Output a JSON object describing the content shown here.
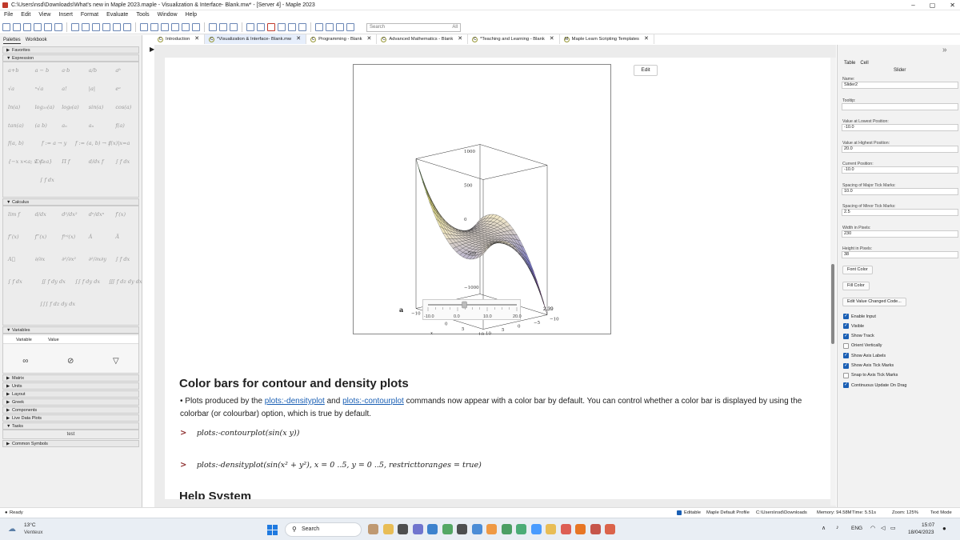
{
  "window": {
    "title": "C:\\Users\\nsd\\Downloads\\What's new in Maple 2023.maple - Visualization & Interface- Blank.mw* - [Server 4] - Maple 2023"
  },
  "menu": [
    "File",
    "Edit",
    "View",
    "Insert",
    "Format",
    "Evaluate",
    "Tools",
    "Window",
    "Help"
  ],
  "toolbar": {
    "search_placeholder": "Search",
    "search_scope": "All"
  },
  "left_panel": {
    "tabs": [
      "Palettes",
      "Workbook"
    ],
    "sections": {
      "favorites": "Favorites",
      "expression": "Expression",
      "calculus": "Calculus",
      "variables": "Variables",
      "matrix": "Matrix",
      "units": "Units",
      "layout": "Layout",
      "greek": "Greek",
      "components": "Components",
      "live_data_plots": "Live Data Plots",
      "tasks": "Tasks",
      "common_symbols": "Common Symbols"
    },
    "variables_cols": [
      "Variable",
      "Value"
    ],
    "tasks_item": "test",
    "expression_items": [
      [
        "a+b",
        "a − b",
        "a·b",
        "a/b",
        "aᵇ"
      ],
      [
        "√a",
        "ⁿ√a",
        "a!",
        "|a|",
        "eᵃ"
      ],
      [
        "ln(a)",
        "log₁₀(a)",
        "logᵦ(a)",
        "sin(a)",
        "cos(a)"
      ],
      [
        "tan(a)",
        "(a b)",
        "aₙ",
        "aₙ",
        "f(a)"
      ],
      [
        "f(a, b)",
        "f := a → y",
        "f := (a, b) → z",
        "f(x)|x=a"
      ],
      [
        "{−x x<a; x x≥a}",
        "Σ f",
        "Π f",
        "d/dx f",
        "∫ f dx"
      ],
      [
        "∫ f dx"
      ]
    ],
    "calculus_items": [
      [
        "lim f",
        "d/dx",
        "d²/dx²",
        "dⁿ/dxⁿ",
        "f′(x)"
      ],
      [
        "f″(x)",
        "f‴(x)",
        "f⁽ⁿ⁾(x)",
        "Ȧ",
        "Ä"
      ],
      [
        "A⃛",
        "∂/∂x",
        "∂²/∂x²",
        "∂²/∂x∂y",
        "∫ f dx"
      ],
      [
        "∫ f dx",
        "∬ f dy dx",
        "∫∫ f dy dx",
        "∭ f dz dy dx"
      ],
      [
        "∫∫∫ f dz dy dx"
      ]
    ]
  },
  "doc_tabs": [
    {
      "label": "Introduction",
      "icon": "C",
      "active": false
    },
    {
      "label": "*Visualization & Interface- Blank.mw",
      "icon": "C",
      "active": true
    },
    {
      "label": "Programming - Blank",
      "icon": "C",
      "active": false
    },
    {
      "label": "Advanced Mathematics - Blank",
      "icon": "C",
      "active": false
    },
    {
      "label": "*Teaching and Learning - Blank",
      "icon": "C",
      "active": false
    },
    {
      "label": "Maple Learn Scripting Templates",
      "icon": "M",
      "active": false
    }
  ],
  "plot": {
    "edit_label": "Edit",
    "z_ticks": [
      "1000",
      "500",
      "0",
      "−500",
      "−1000"
    ],
    "x_ticks": [
      "−10",
      "−5",
      "0",
      "5",
      "10"
    ],
    "y_ticks": [
      "10",
      "5",
      "0",
      "−5",
      "−10"
    ],
    "x_axis_label": "x",
    "y_axis_label": "y",
    "slider_label": "a",
    "slider_ticks": [
      "-10.0",
      "0.0",
      "10.0",
      "20.0"
    ],
    "slider_value": "2.39",
    "slider_position_fraction": 0.41
  },
  "content": {
    "heading_colorbars": "Color bars for contour and density plots",
    "para_text1": "Plots produced by the ",
    "link1": "plots:-densityplot",
    "para_text2": " and ",
    "link2": "plots:-contourplot",
    "para_text3": " commands now appear with a color bar by default. You can control whether a color bar is displayed by using the colorbar (or colourbar) option, which is true by default.",
    "cmd1": "plots:-contourplot(sin(x y))",
    "cmd2": "plots:-densityplot(sin(x² + y²), x = 0 ..5, y = 0 ..5, restricttoranges = true)",
    "heading_help": "Help System"
  },
  "right_panel": {
    "tabs": [
      "Table",
      "Cell"
    ],
    "section_title": "Slider",
    "fields": [
      {
        "label": "Name:",
        "value": "Slider2"
      },
      {
        "label": "Tooltip:",
        "value": ""
      },
      {
        "label": "Value at Lowest Position:",
        "value": "-10.0"
      },
      {
        "label": "Value at Highest Position:",
        "value": "20.0"
      },
      {
        "label": "Current Position:",
        "value": "-10.0"
      },
      {
        "label": "Spacing of Major Tick Marks:",
        "value": "10.0"
      },
      {
        "label": "Spacing of Minor Tick Marks:",
        "value": "2.5"
      },
      {
        "label": "Width in Pixels:",
        "value": "230"
      },
      {
        "label": "Height in Pixels:",
        "value": "38"
      }
    ],
    "buttons": [
      "Font Color",
      "Fill Color",
      "Edit Value Changed Code..."
    ],
    "checkboxes": [
      {
        "label": "Enable Input",
        "checked": true
      },
      {
        "label": "Visible",
        "checked": true
      },
      {
        "label": "Show Track",
        "checked": true
      },
      {
        "label": "Orient Vertically",
        "checked": false
      },
      {
        "label": "Show Axis Labels",
        "checked": true
      },
      {
        "label": "Show Axis Tick Marks",
        "checked": true
      },
      {
        "label": "Snap to Axis Tick Marks",
        "checked": false
      },
      {
        "label": "Continuous Update On Drag",
        "checked": true
      }
    ]
  },
  "status": {
    "ready": "Ready",
    "editable": "Editable",
    "profile": "Maple Default Profile",
    "path": "C:\\Users\\nsd\\Downloads",
    "memory": "Memory: 94.58M",
    "time": "Time: 5.51s",
    "zoom": "Zoom: 125%",
    "mode": "Text Mode"
  },
  "taskbar": {
    "weather_temp": "13°C",
    "weather_desc": "Venteux",
    "search_label": "Search",
    "lang": "ENG",
    "time": "15:07",
    "date": "18/04/2023"
  },
  "colors": {
    "accent": "#1a5fb4",
    "prompt": "#8b2b2b",
    "link": "#1a5fb4"
  }
}
